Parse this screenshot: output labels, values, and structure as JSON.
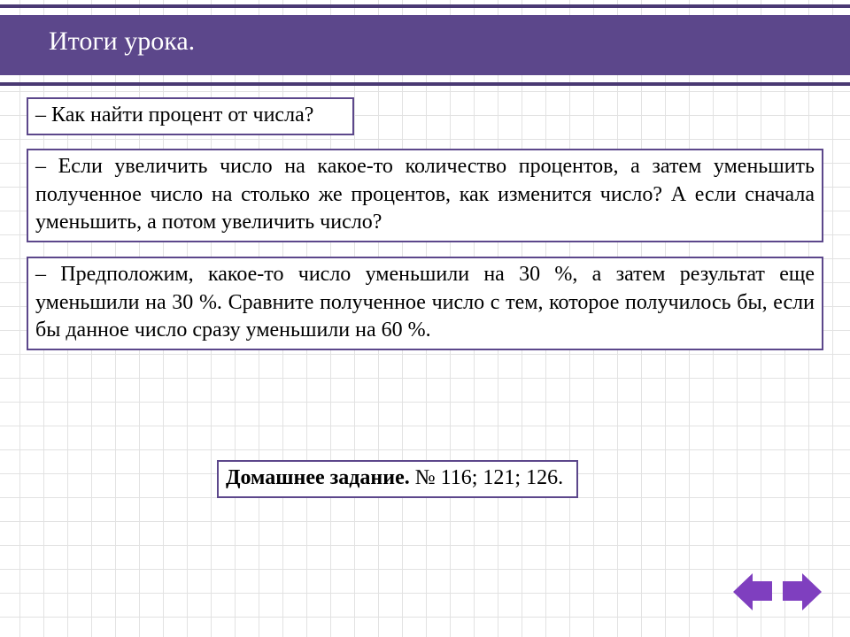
{
  "title": "Итоги урока.",
  "q1": "– Как найти процент от числа?",
  "q2": "– Если увеличить число на какое-то количество процентов, а затем уменьшить полученное число на столько же процентов, как изменится число? А если сначала уменьшить, а потом увеличить число?",
  "q3": "– Предположим, какое-то число уменьшили на 30 %, а затем результат еще уменьшили на 30 %. Сравните полученное число с тем, которое получилось бы, если бы данное число сразу уменьшили на 60 %.",
  "hw_label": "Домашнее задание.",
  "hw_items": "  № 116;  121;  126."
}
